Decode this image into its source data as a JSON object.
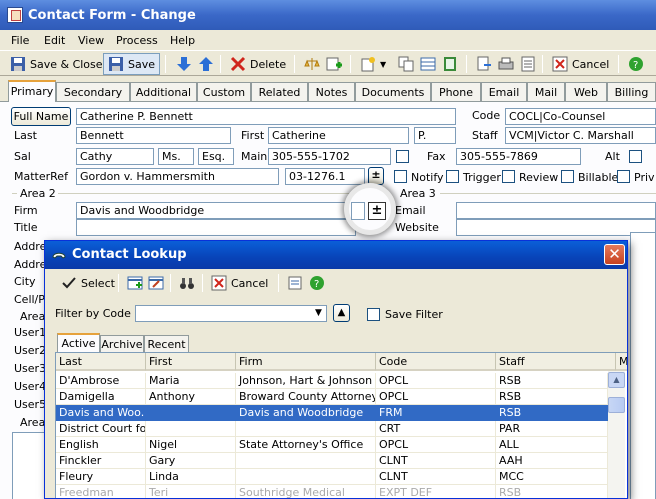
{
  "window": {
    "title": "Contact Form - Change"
  },
  "menu": [
    "File",
    "Edit",
    "View",
    "Process",
    "Help"
  ],
  "toolbar": {
    "save_close": "Save & Close",
    "save": "Save",
    "delete": "Delete",
    "cancel": "Cancel"
  },
  "tabs": [
    "Primary",
    "Secondary",
    "Additional",
    "Custom",
    "Related",
    "Notes",
    "Documents",
    "Phone",
    "Email",
    "Mail",
    "Web",
    "Billing"
  ],
  "form": {
    "full_name_button": "Full Name",
    "full_name": "Catherine P. Bennett",
    "code_label": "Code",
    "code": "COCL|Co-Counsel",
    "last_label": "Last",
    "last": "Bennett",
    "first_label": "First",
    "first": "Catherine",
    "middle": "P.",
    "staff_label": "Staff",
    "staff": "VCM|Victor C. Marshall",
    "sal_label": "Sal",
    "sal": "Cathy",
    "prefix": "Ms.",
    "suffix": "Esq.",
    "main_label": "Main",
    "main": "305-555-1702",
    "fax_label": "Fax",
    "fax": "305-555-7869",
    "alt_label": "Alt",
    "matterref_label": "MatterRef",
    "matterref": "Gordon v. Hammersmith",
    "matterref_code": "03-1276.1",
    "notify_label": "Notify",
    "trigger_label": "Trigger",
    "review_label": "Review",
    "billable_label": "Billable",
    "priv_label": "Priv",
    "area2_label": "Area 2",
    "area3_label": "Area 3",
    "firm_label": "Firm",
    "firm": "Davis and Woodbridge",
    "email_label": "Email",
    "title_label": "Title",
    "website_label": "Website",
    "address_label": "Addres",
    "city_label": "City",
    "cellp_label": "Cell/P",
    "area_label": "Area",
    "user_labels": [
      "User1",
      "User2",
      "User3",
      "User4",
      "User5"
    ],
    "plus": "±"
  },
  "lookup": {
    "title": "Contact Lookup",
    "select": "Select",
    "cancel": "Cancel",
    "filter_label": "Filter by Code",
    "save_filter": "Save Filter",
    "tabs": [
      "Active",
      "Archive",
      "Recent"
    ],
    "columns": [
      "Last",
      "First",
      "Firm",
      "Code",
      "Staff",
      "M"
    ],
    "rows": [
      [
        "D'Ambrose",
        "Maria",
        "Johnson, Hart & Johnson",
        "OPCL",
        "RSB"
      ],
      [
        "Damigella",
        "Anthony",
        "Broward County Attorney",
        "OPCL",
        "RSB"
      ],
      [
        "Davis and Woo...",
        "",
        "Davis and Woodbridge",
        "FRM",
        "RSB"
      ],
      [
        "District Court for...",
        "",
        "",
        "CRT",
        "PAR"
      ],
      [
        "English",
        "Nigel",
        "State Attorney's Office",
        "OPCL",
        "ALL"
      ],
      [
        "Finckler",
        "Gary",
        "",
        "CLNT",
        "AAH"
      ],
      [
        "Fleury",
        "Linda",
        "",
        "CLNT",
        "MCC"
      ],
      [
        "Freedman",
        "Teri",
        "Southridge Medical",
        "EXPT DEF",
        "RSB"
      ]
    ],
    "selected_row": 2
  }
}
